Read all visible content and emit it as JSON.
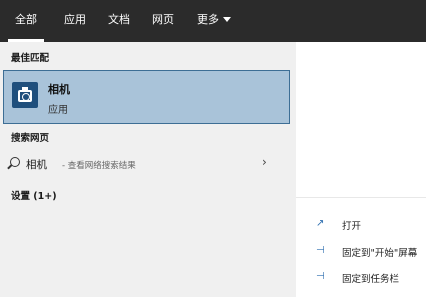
{
  "tabs": [
    {
      "label": "全部"
    },
    {
      "label": "应用"
    },
    {
      "label": "文档"
    },
    {
      "label": "网页"
    },
    {
      "label": "更多"
    }
  ],
  "left": {
    "best_match_title": "最佳匹配",
    "best_match": {
      "name": "相机",
      "type": "应用"
    },
    "web_title": "搜索网页",
    "web_result": {
      "term": "相机",
      "suffix": "- 查看网络搜索结果"
    },
    "settings_title": "设置 (1+)"
  },
  "actions": [
    {
      "icon": "open-icon",
      "label": "打开"
    },
    {
      "icon": "pin-icon",
      "label": "固定到\"开始\"屏幕"
    },
    {
      "icon": "pin-icon",
      "label": "固定到任务栏"
    }
  ],
  "colors": {
    "topbar": "#2b2b2b",
    "selected": "#a9c3d9",
    "selected_border": "#3d6e95"
  }
}
